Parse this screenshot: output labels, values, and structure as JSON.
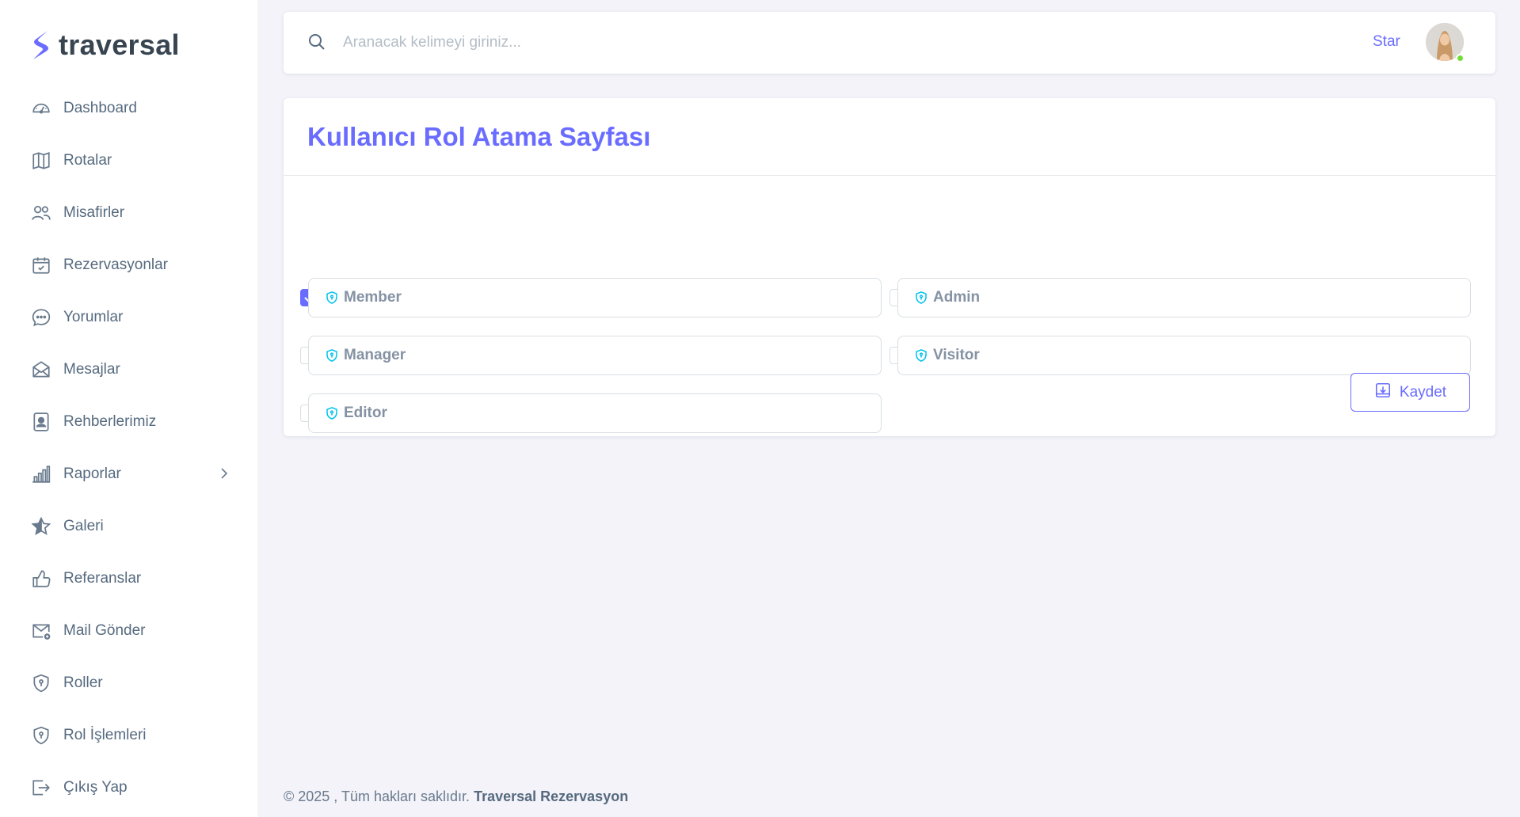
{
  "brand": {
    "name": "traversal",
    "accent": "#696cff"
  },
  "sidebar": {
    "items": [
      {
        "label": "Dashboard",
        "icon": "gauge-icon"
      },
      {
        "label": "Rotalar",
        "icon": "map-icon"
      },
      {
        "label": "Misafirler",
        "icon": "users-icon"
      },
      {
        "label": "Rezervasyonlar",
        "icon": "calendar-check-icon"
      },
      {
        "label": "Yorumlar",
        "icon": "chat-icon"
      },
      {
        "label": "Mesajlar",
        "icon": "envelope-open-icon"
      },
      {
        "label": "Rehberlerimiz",
        "icon": "contact-card-icon"
      },
      {
        "label": "Raporlar",
        "icon": "bar-chart-icon",
        "has_submenu": true
      },
      {
        "label": "Galeri",
        "icon": "star-icon"
      },
      {
        "label": "Referanslar",
        "icon": "thumbs-up-icon"
      },
      {
        "label": "Mail Gönder",
        "icon": "mail-send-icon"
      },
      {
        "label": "Roller",
        "icon": "shield-icon"
      },
      {
        "label": "Rol İşlemleri",
        "icon": "shield-icon"
      },
      {
        "label": "Çıkış Yap",
        "icon": "logout-icon"
      }
    ]
  },
  "topbar": {
    "search_placeholder": "Aranacak kelimeyi giriniz...",
    "user_name": "Star",
    "user_status_color": "#71dd37"
  },
  "page": {
    "title": "Kullanıcı Rol Atama Sayfası",
    "roles": [
      {
        "label": "Member",
        "checked": true
      },
      {
        "label": "Admin",
        "checked": false
      },
      {
        "label": "Manager",
        "checked": false
      },
      {
        "label": "Visitor",
        "checked": false
      },
      {
        "label": "Editor",
        "checked": false
      }
    ],
    "save_label": "Kaydet"
  },
  "footer": {
    "prefix": "© 2025 , Tüm hakları saklıdır.",
    "company": "Traversal Rezervasyon"
  }
}
